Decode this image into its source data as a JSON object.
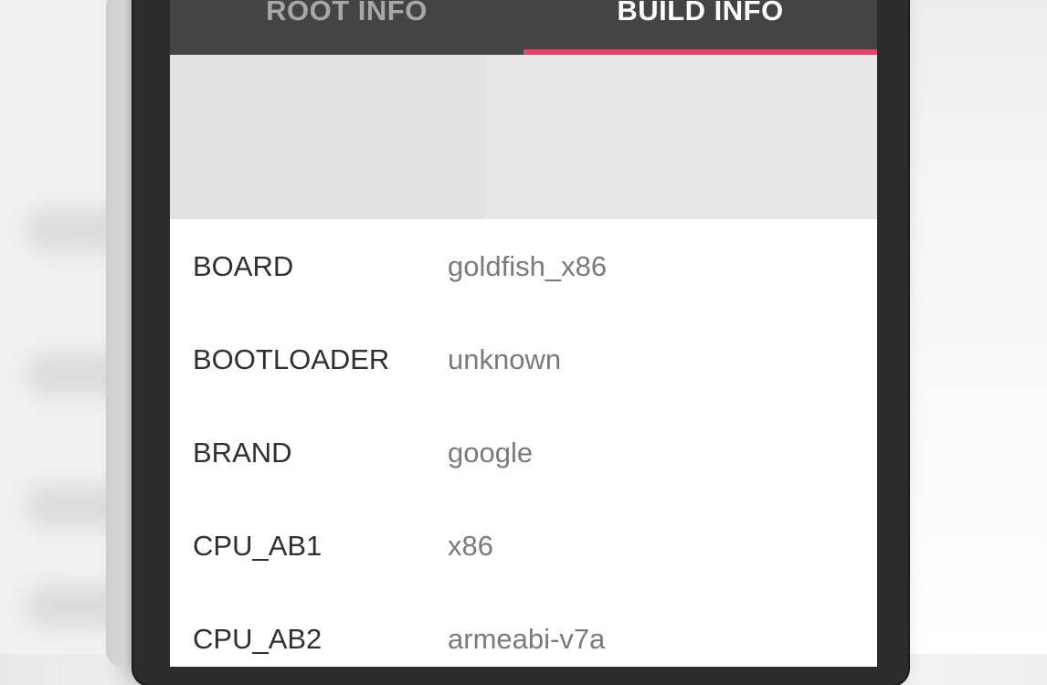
{
  "tabs": [
    {
      "label": "ROOT INFO",
      "selected": false
    },
    {
      "label": "BUILD INFO",
      "selected": true
    }
  ],
  "accent_color": "#e7416b",
  "build_info": [
    {
      "key": "BOARD",
      "value": "goldfish_x86"
    },
    {
      "key": "BOOTLOADER",
      "value": "unknown"
    },
    {
      "key": "BRAND",
      "value": "google"
    },
    {
      "key": "CPU_AB1",
      "value": "x86"
    },
    {
      "key": "CPU_AB2",
      "value": "armeabi-v7a"
    }
  ]
}
